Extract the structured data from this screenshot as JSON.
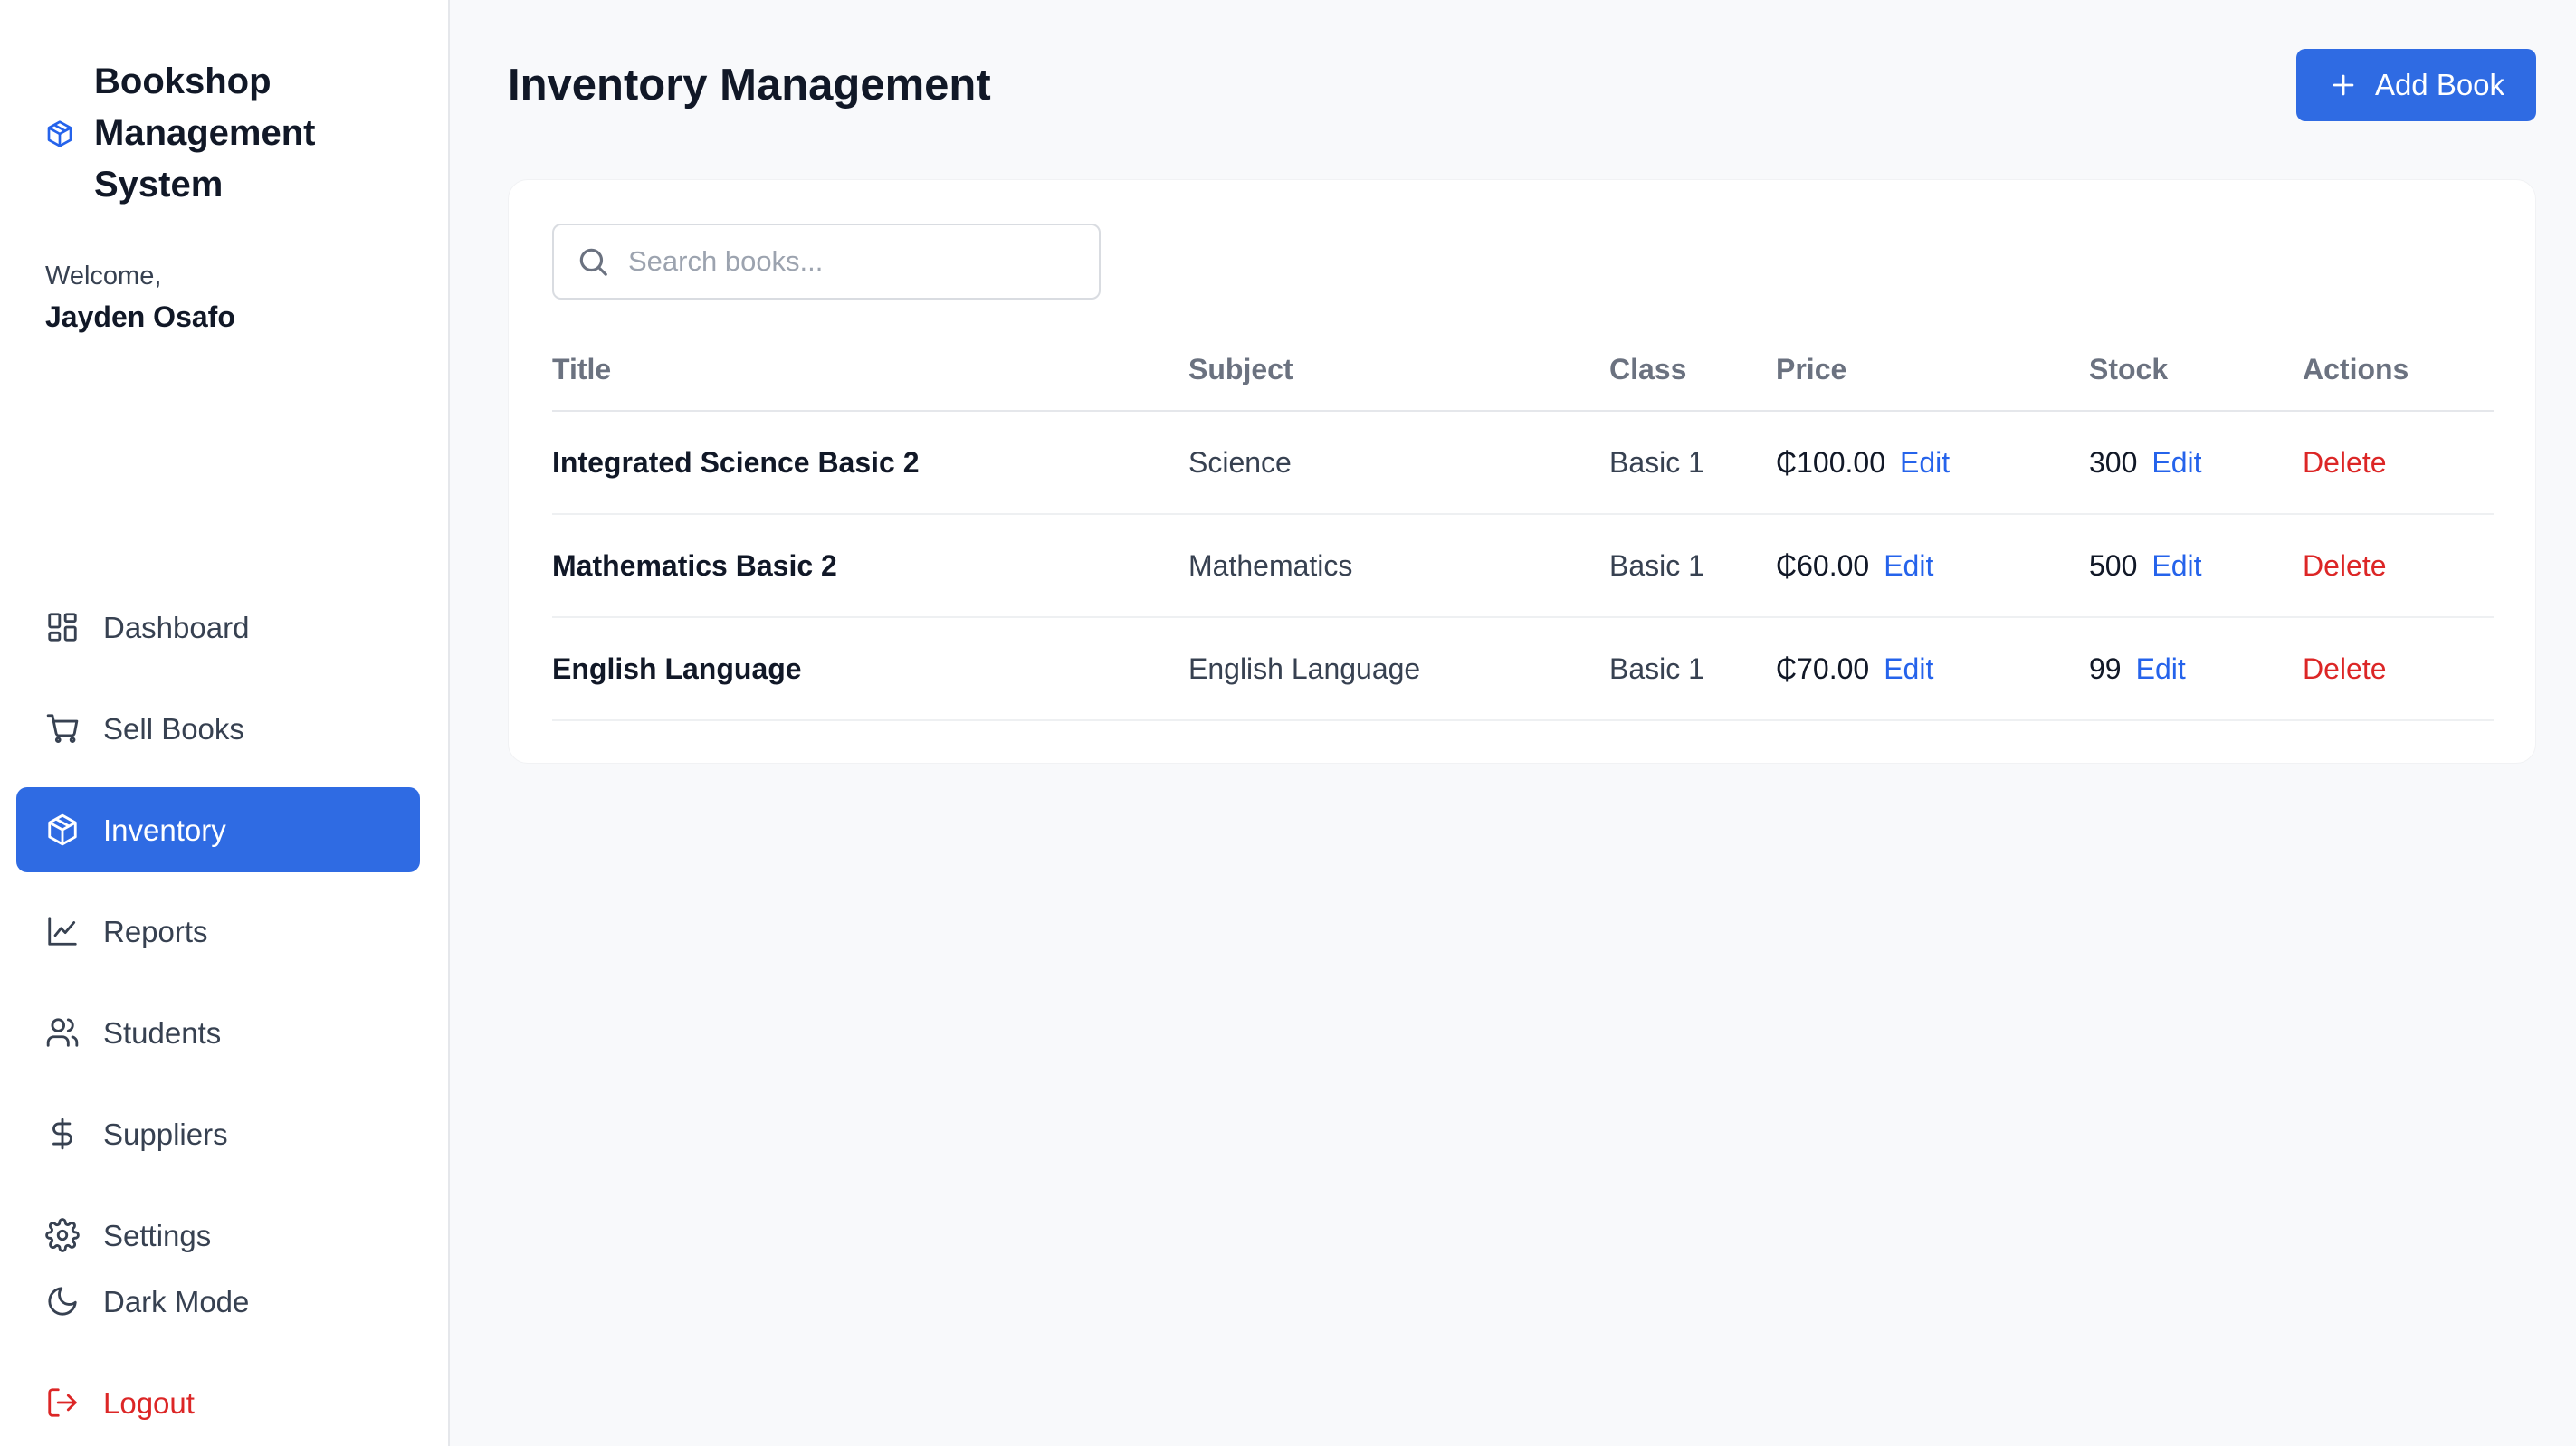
{
  "sidebar": {
    "brand": "Bookshop Management System",
    "welcome_label": "Welcome,",
    "user_name": "Jayden Osafo",
    "items": [
      {
        "label": "Dashboard",
        "icon": "dashboard-icon"
      },
      {
        "label": "Sell Books",
        "icon": "cart-icon"
      },
      {
        "label": "Inventory",
        "icon": "box-icon",
        "active": true
      },
      {
        "label": "Reports",
        "icon": "chart-icon"
      },
      {
        "label": "Students",
        "icon": "users-icon"
      },
      {
        "label": "Suppliers",
        "icon": "dollar-icon"
      },
      {
        "label": "Settings",
        "icon": "gear-icon"
      }
    ],
    "dark_mode_label": "Dark Mode",
    "logout_label": "Logout"
  },
  "header": {
    "title": "Inventory Management",
    "add_button_label": "Add Book"
  },
  "search": {
    "placeholder": "Search books..."
  },
  "table": {
    "columns": [
      "Title",
      "Subject",
      "Class",
      "Price",
      "Stock",
      "Actions"
    ],
    "edit_label": "Edit",
    "delete_label": "Delete",
    "rows": [
      {
        "title": "Integrated Science Basic 2",
        "subject": "Science",
        "class": "Basic 1",
        "price": "₵100.00",
        "stock": "300"
      },
      {
        "title": "Mathematics Basic 2",
        "subject": "Mathematics",
        "class": "Basic 1",
        "price": "₵60.00",
        "stock": "500"
      },
      {
        "title": "English Language",
        "subject": "English Language",
        "class": "Basic 1",
        "price": "₵70.00",
        "stock": "99"
      }
    ]
  },
  "colors": {
    "accent": "#2f6be3",
    "danger": "#dc2626",
    "link": "#2563eb"
  }
}
